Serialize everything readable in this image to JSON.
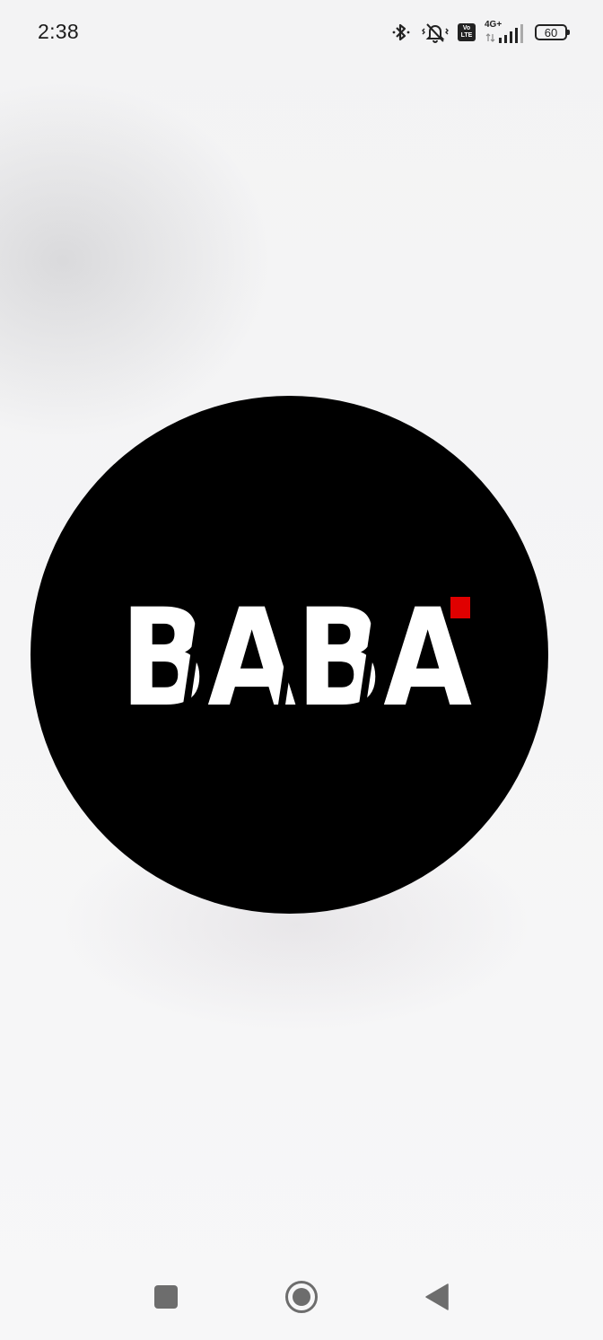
{
  "status_bar": {
    "time": "2:38",
    "network": "4G+",
    "volte_top": "Vo",
    "volte_bottom": "LTE",
    "battery": "60",
    "icons": [
      "bluetooth-icon",
      "muted-vibrate-icon",
      "volte-icon",
      "signal-icon",
      "battery-icon"
    ]
  },
  "splash": {
    "logo_text": "BABA",
    "accent_color": "#e00000",
    "circle_color": "#000000",
    "text_color": "#ffffff"
  },
  "nav_bar": {
    "buttons": [
      "recents-button",
      "home-button",
      "back-button"
    ]
  }
}
